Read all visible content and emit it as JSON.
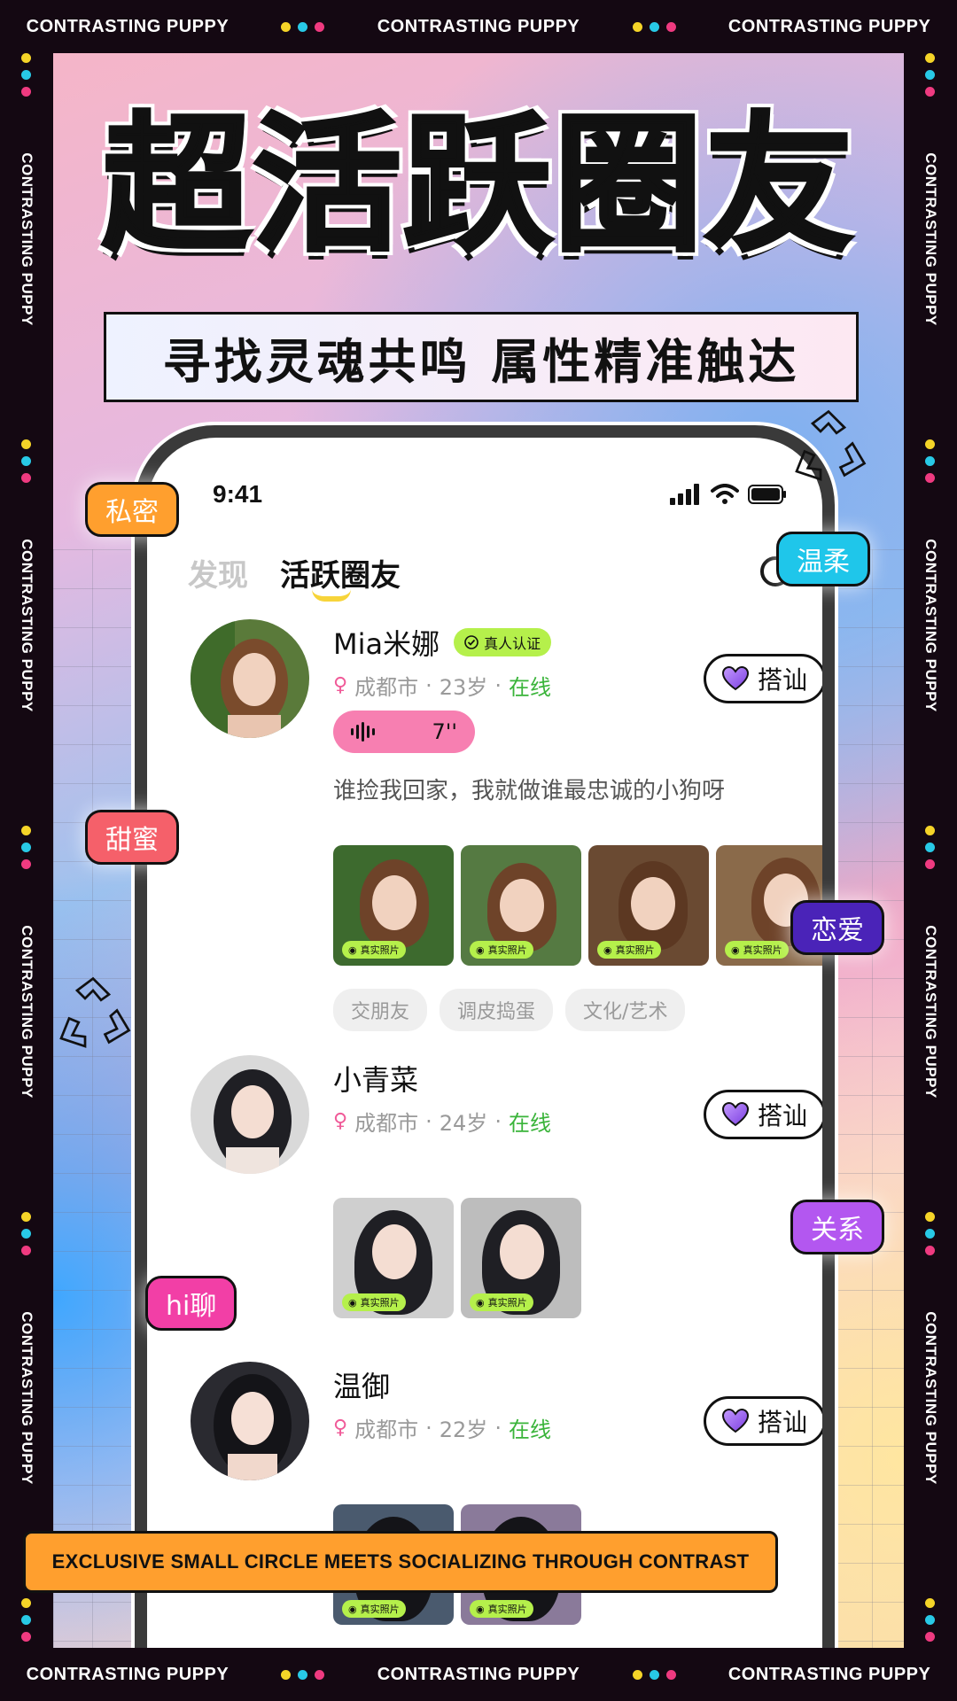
{
  "frame": {
    "word": "CONTRASTING PUPPY"
  },
  "header": {
    "headline": "超活跃圈友",
    "subtitle": "寻找灵魂共鸣 属性精准触达"
  },
  "status_bar": {
    "time": "9:41"
  },
  "tabs": [
    {
      "label": "发现",
      "active": false
    },
    {
      "label": "活跃圈友",
      "active": true
    }
  ],
  "profiles": [
    {
      "name": "Mia米娜",
      "verified_label": "真人认证",
      "city": "成都市",
      "age": "23岁",
      "status": "在线",
      "voice_duration": "7''",
      "bio": "谁捡我回家，我就做谁最忠诚的小狗呀",
      "greet_label": "搭讪",
      "photo_badge": "真实照片",
      "tags": [
        "交朋友",
        "调皮捣蛋",
        "文化/艺术"
      ]
    },
    {
      "name": "小青菜",
      "city": "成都市",
      "age": "24岁",
      "status": "在线",
      "greet_label": "搭讪",
      "photo_badge": "真实照片"
    },
    {
      "name": "温御",
      "city": "成都市",
      "age": "22岁",
      "status": "在线",
      "greet_label": "搭讪",
      "photo_badge": "真实照片"
    }
  ],
  "floating_tags": [
    {
      "label": "私密",
      "color": "#ff9f2e"
    },
    {
      "label": "温柔",
      "color": "#1fc6ea"
    },
    {
      "label": "甜蜜",
      "color": "#f5606a"
    },
    {
      "label": "恋爱",
      "color": "#4a23b8"
    },
    {
      "label": "关系",
      "color": "#b357f0"
    },
    {
      "label": "hi聊",
      "color": "#f23fa6"
    }
  ],
  "banner": {
    "text": "EXCLUSIVE SMALL CIRCLE MEETS SOCIALIZING THROUGH CONTRAST"
  },
  "colors": {
    "frame": "#140812",
    "verify": "#b5f04b",
    "online": "#3ab43a",
    "voice": "#f77fb1",
    "banner": "#ff9f2e"
  }
}
